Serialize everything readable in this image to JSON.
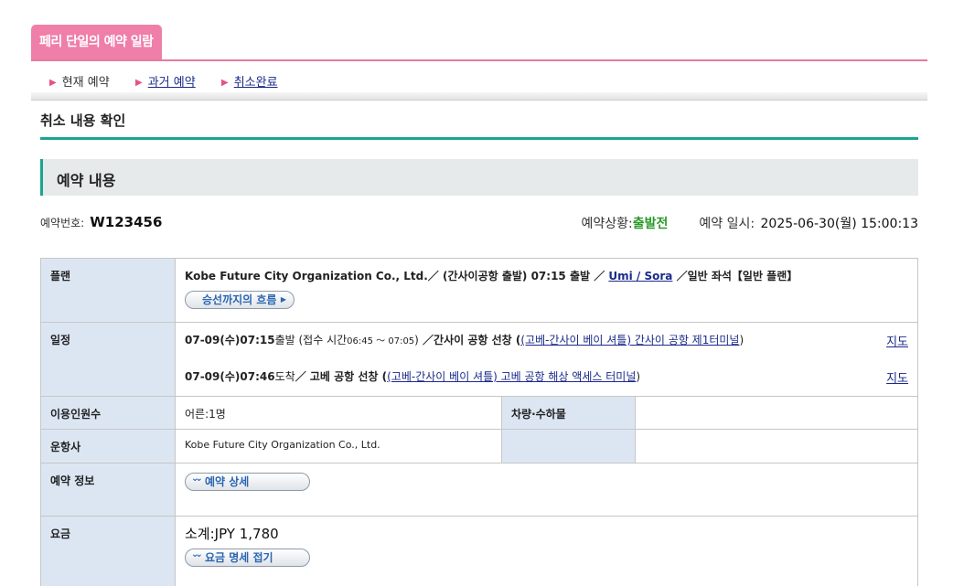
{
  "header": {
    "tab_title": "페리 단일의 예약 일람",
    "nav": [
      {
        "label": "현재 예약",
        "link": false
      },
      {
        "label": "과거 예약",
        "link": true
      },
      {
        "label": "취소완료",
        "link": true
      }
    ]
  },
  "page": {
    "title": "취소 내용 확인",
    "section_title": "예약 내용"
  },
  "reservation": {
    "number_label": "예약번호:",
    "number": "W123456",
    "status_label": "예약상황:",
    "status": "출발전",
    "datetime_label": "예약 일시:",
    "datetime": "2025-06-30(월) 15:00:13"
  },
  "table": {
    "plan": {
      "label": "플랜",
      "prefix": "Kobe Future City Organization Co., Ltd.／ (간사이공항 출발) 07:15 출발 ／ ",
      "ship_link": "Umi / Sora",
      "suffix": " ／일반 좌석【일반 플랜】",
      "flow_button": "승선까지의 흐름"
    },
    "schedule": {
      "label": "일정",
      "dep_bold": "07-09(수)07:15",
      "dep_text": "출발 ",
      "dep_reception": "(접수 시간",
      "dep_reception_time": "06:45 ～ 07:05",
      "dep_reception_end": ")",
      "dep_port": " ／간사이 공항 선창 (",
      "dep_link": "(고베-간사이 베이 셔틀) 간사이 공항 제1터미널",
      "dep_end": ")",
      "arr_bold": "07-09(수)07:46",
      "arr_text": "도착",
      "arr_port": "／ 고베 공항 선창 (",
      "arr_link": "(고베-간사이 베이 셔틀) 고베 공항 해상 액세스 터미널",
      "arr_end": ")",
      "map_label": "지도"
    },
    "passengers": {
      "label": "이용인원수",
      "value": "어른:1명",
      "vehicle_label": "차량·수하물",
      "vehicle_value": ""
    },
    "operator": {
      "label": "운항사",
      "value": "Kobe Future City Organization Co., Ltd."
    },
    "info": {
      "label": "예약 정보",
      "button": "예약 상세"
    },
    "fare": {
      "label": "요금",
      "subtotal": "소계:JPY 1,780",
      "button": "요금 명세 접기"
    }
  }
}
